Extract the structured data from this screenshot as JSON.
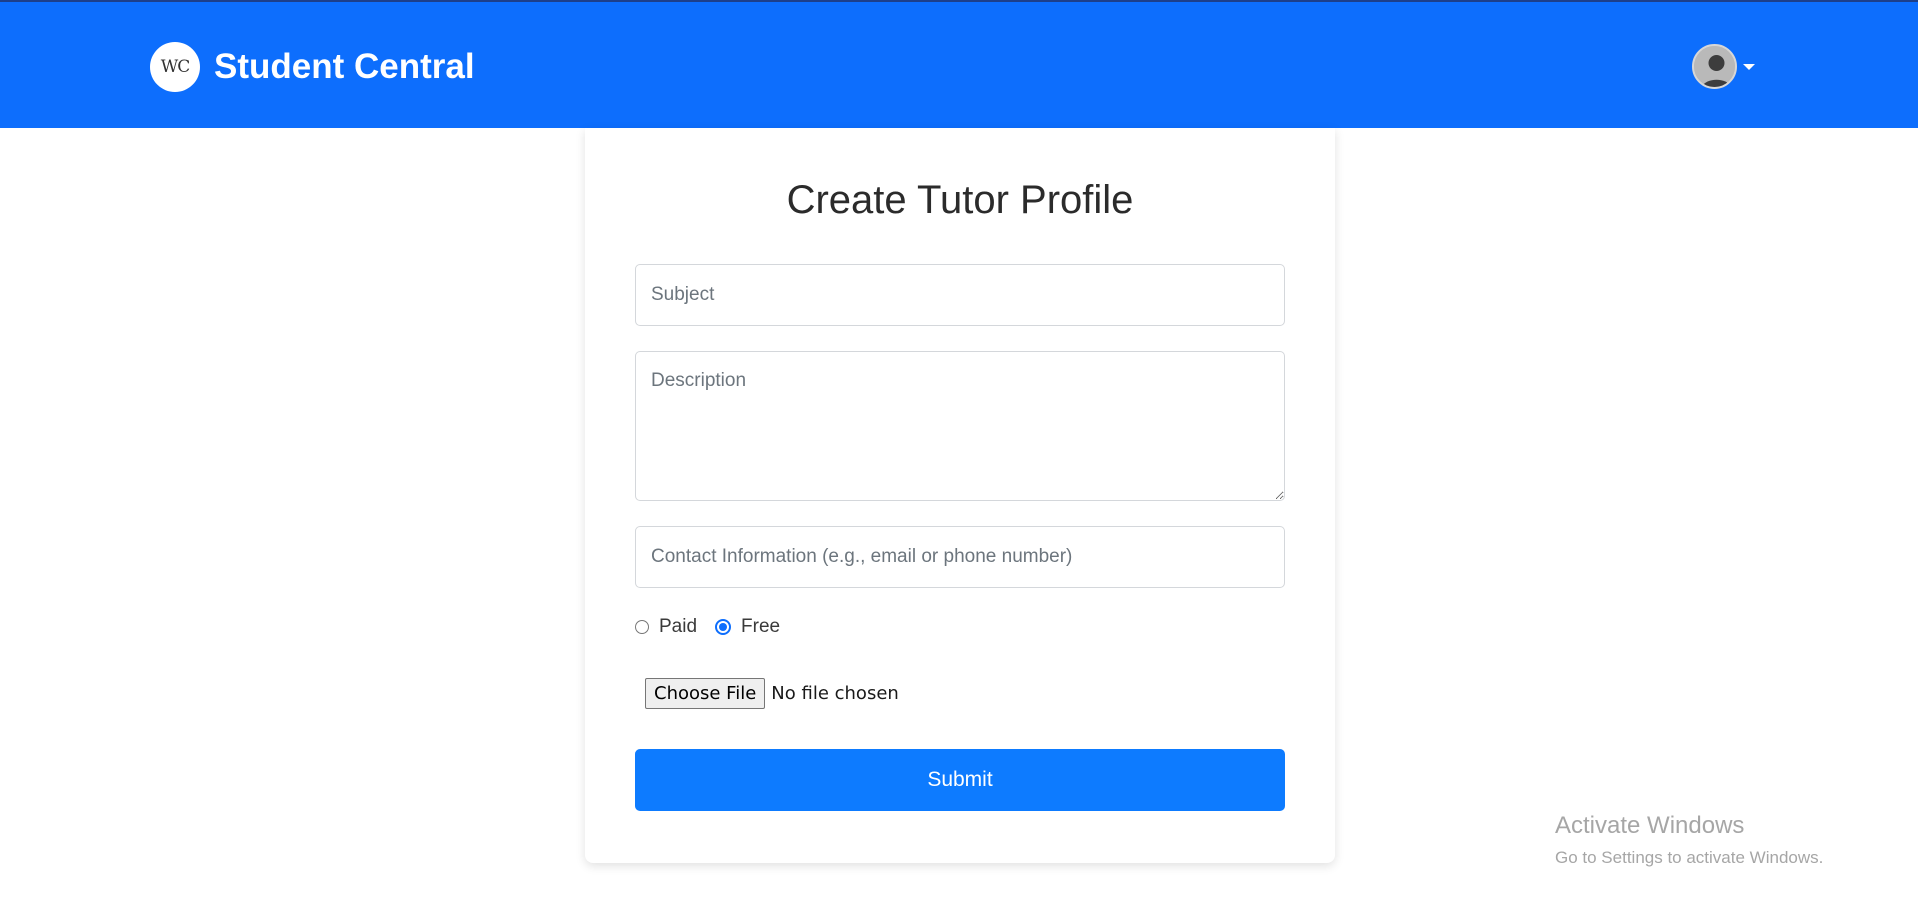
{
  "navbar": {
    "logo_text": "WC",
    "brand": "Student Central"
  },
  "form": {
    "title": "Create Tutor Profile",
    "subject_placeholder": "Subject",
    "description_placeholder": "Description",
    "contact_placeholder": "Contact Information (e.g., email or phone number)",
    "pricing": {
      "options": [
        "Paid",
        "Free"
      ],
      "selected": "Free"
    },
    "file": {
      "button": "Choose File",
      "status": "No file chosen"
    },
    "submit_label": "Submit"
  },
  "watermark": {
    "title": "Activate Windows",
    "subtitle": "Go to Settings to activate Windows."
  },
  "colors": {
    "navbar": "#0d6efd",
    "submit": "#0d7bff",
    "radio_checked": "#0d6efd"
  }
}
